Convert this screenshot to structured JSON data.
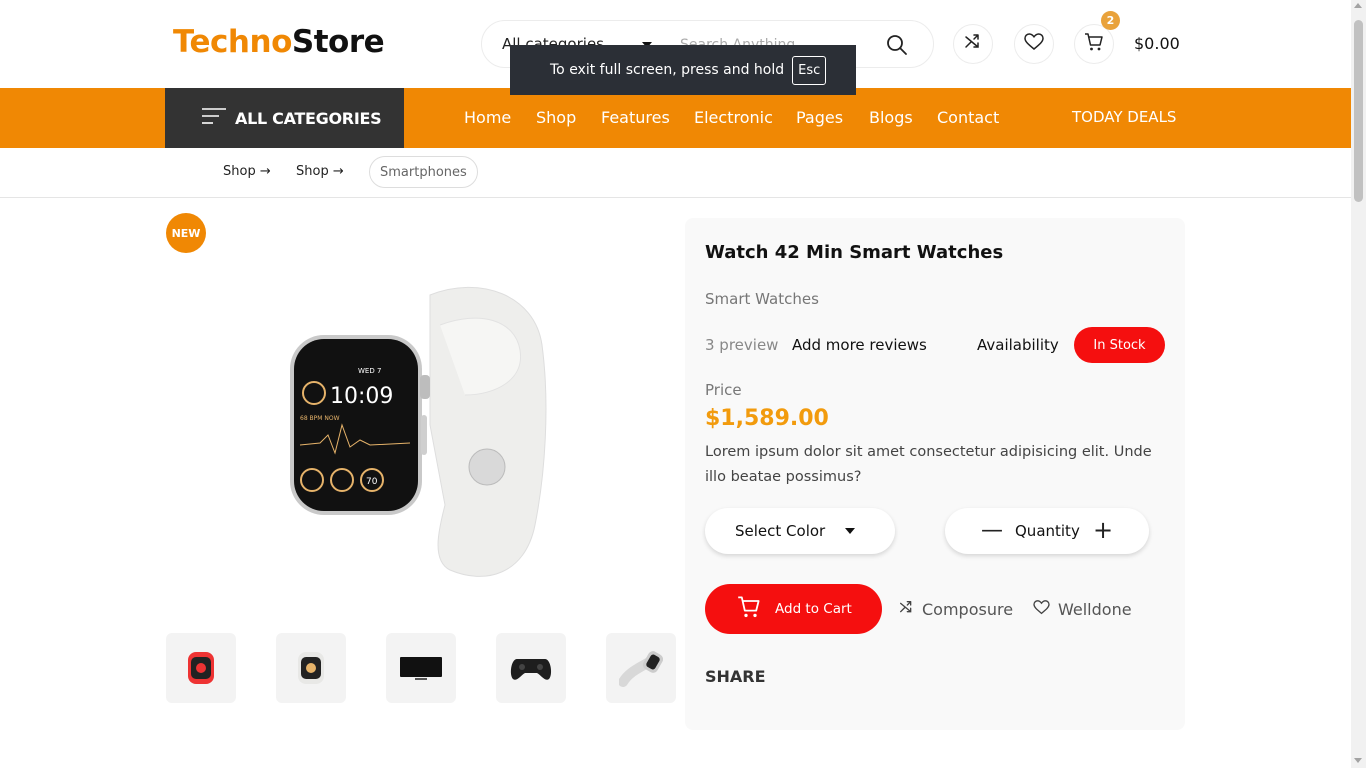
{
  "header": {
    "logo_part1": "Techno",
    "logo_part2": "Store",
    "search": {
      "category": "All categories",
      "placeholder": "Search Anything"
    },
    "cart_count": "2",
    "cart_total": "$0.00"
  },
  "toast": {
    "message": "To exit full screen, press and hold",
    "key": "Esc"
  },
  "nav": {
    "all_categories": "ALL CATEGORIES",
    "items": [
      "Home",
      "Shop",
      "Features",
      "Electronic",
      "Pages",
      "Blogs",
      "Contact"
    ],
    "today_deals": "TODAY DEALS"
  },
  "breadcrumb": {
    "items": [
      "Shop",
      "Shop"
    ],
    "current": "Smartphones"
  },
  "gallery": {
    "badge": "NEW",
    "thumbnails": [
      "red-smartwatch",
      "white-smartwatch",
      "monitor",
      "gamepad",
      "sport-smartwatch"
    ]
  },
  "product": {
    "title": "Watch 42 Min Smart Watches",
    "category": "Smart Watches",
    "reviews": "3 preview",
    "add_reviews": "Add more reviews",
    "availability_label": "Availability",
    "stock_status": "In Stock",
    "price_label": "Price",
    "price": "$1,589.00",
    "description": "Lorem ipsum dolor sit amet consectetur adipisicing elit. Unde illo beatae possimus?",
    "select_color": "Select Color",
    "quantity_label": "Quantity",
    "add_to_cart": "Add to Cart",
    "compare": "Composure",
    "wishlist": "Welldone",
    "share": "SHARE"
  },
  "colors": {
    "brand_orange": "#f08804",
    "price_orange": "#f29b0d",
    "stock_red": "#f50f0f",
    "dark_nav": "#333333"
  }
}
